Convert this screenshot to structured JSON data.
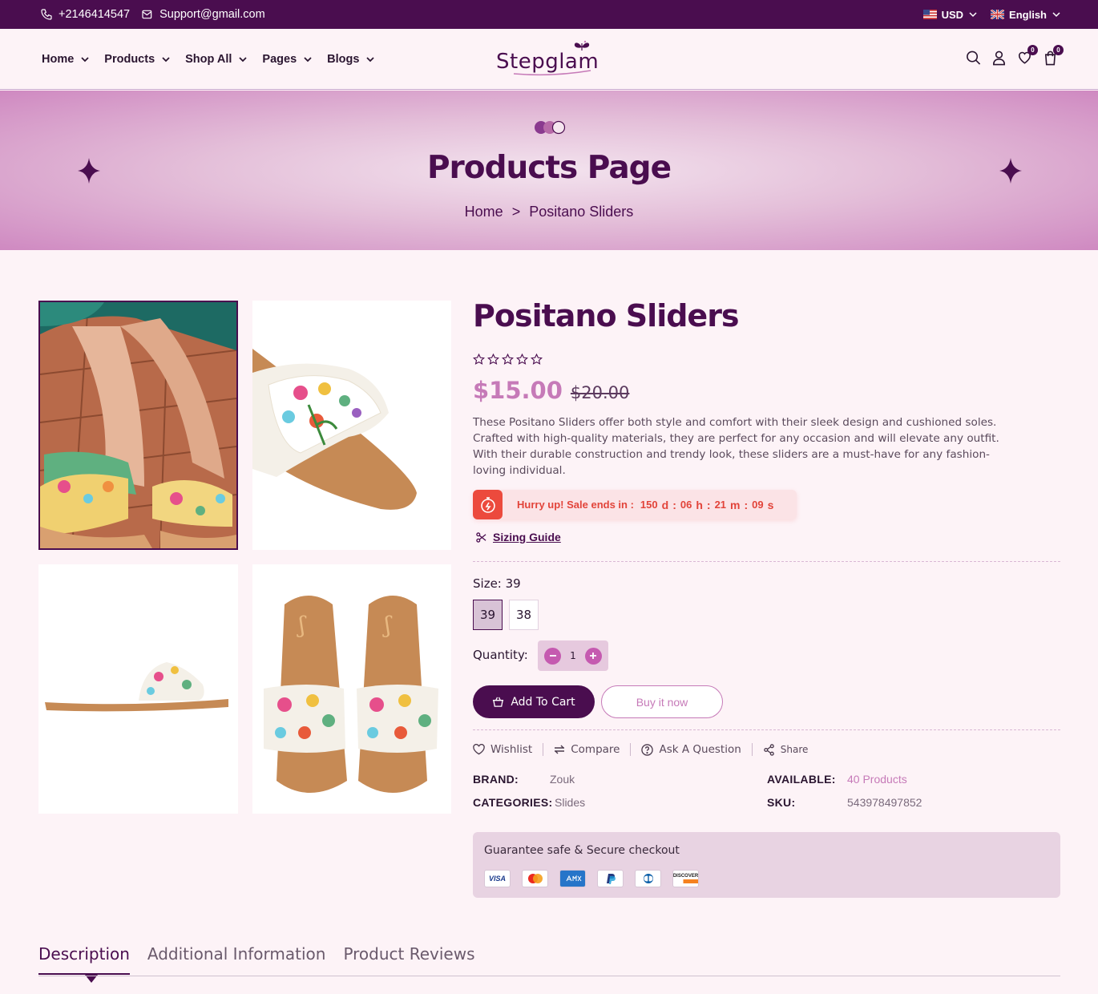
{
  "topbar": {
    "phone": "+2146414547",
    "email": "Support@gmail.com",
    "currency": "USD",
    "language": "English"
  },
  "nav": {
    "items": [
      {
        "label": "Home"
      },
      {
        "label": "Products"
      },
      {
        "label": "Shop All"
      },
      {
        "label": "Pages"
      },
      {
        "label": "Blogs"
      }
    ],
    "logo": "Stepglam",
    "wishlist_count": "0",
    "cart_count": "0"
  },
  "banner": {
    "title": "Products Page",
    "crumb_home": "Home",
    "crumb_sep": ">",
    "crumb_current": "Positano Sliders"
  },
  "product": {
    "title": "Positano Sliders",
    "rating": 0,
    "rating_max": 5,
    "price": "$15.00",
    "old_price": "$20.00",
    "description": "These Positano Sliders offer both style and comfort with their sleek design and cushioned soles. Crafted with high-quality materials, they are perfect for any occasion and will elevate any outfit. With their durable construction and trendy look, these sliders are a must-have for any fashion-loving individual.",
    "sale_label": "Hurry up! Sale ends in :",
    "countdown": {
      "days": "150",
      "d": "d",
      "hours": "06",
      "h": "h",
      "minutes": "21",
      "m": "m",
      "seconds": "09",
      "s": "s"
    },
    "sizing_guide": "Sizing Guide",
    "size_label": "Size: 39",
    "sizes": [
      "39",
      "38"
    ],
    "selected_size": "39",
    "quantity_label": "Quantity:",
    "quantity": "1",
    "add_to_cart": "Add To Cart",
    "buy_now": "Buy it now",
    "actions": {
      "wishlist": "Wishlist",
      "compare": "Compare",
      "ask": "Ask A Question",
      "share": "Share"
    },
    "meta": {
      "brand_label": "BRAND:",
      "brand": "Zouk",
      "categories_label": "CATEGORIES:",
      "categories": "Slides",
      "available_label": "AVAILABLE:",
      "available": "40 Products",
      "sku_label": "SKU:",
      "sku": "543978497852"
    },
    "guarantee": "Guarantee safe & Secure checkout",
    "payment_cards": [
      "VISA",
      "mastercard",
      "american-express",
      "paypal",
      "diners-club",
      "DISCOVER"
    ]
  },
  "tabs": {
    "description": "Description",
    "additional": "Additional Information",
    "reviews": "Product Reviews"
  },
  "colors": {
    "brand": "#4a0d4f",
    "accent": "#c67ab8",
    "sale": "#ec4a3d",
    "background": "#fdf3f7"
  }
}
